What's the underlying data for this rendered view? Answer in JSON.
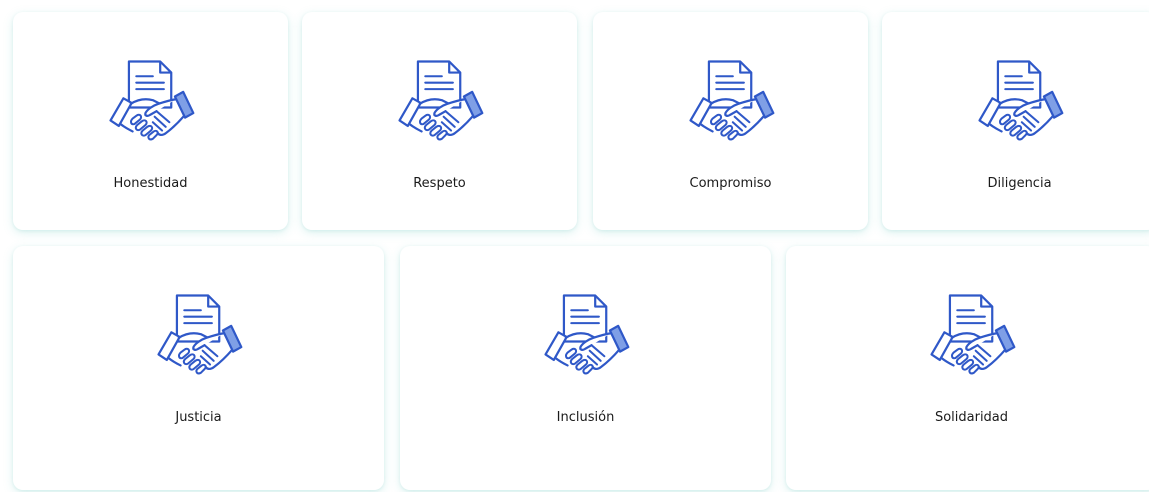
{
  "icon": "document-handshake-icon",
  "colors": {
    "icon_stroke": "#2f58c8",
    "icon_fill": "#7f9fe6",
    "card_shadow": "#c9eeea"
  },
  "values": [
    {
      "label": "Honestidad"
    },
    {
      "label": "Respeto"
    },
    {
      "label": "Compromiso"
    },
    {
      "label": "Diligencia"
    },
    {
      "label": "Justicia"
    },
    {
      "label": "Inclusión"
    },
    {
      "label": "Solidaridad"
    }
  ]
}
